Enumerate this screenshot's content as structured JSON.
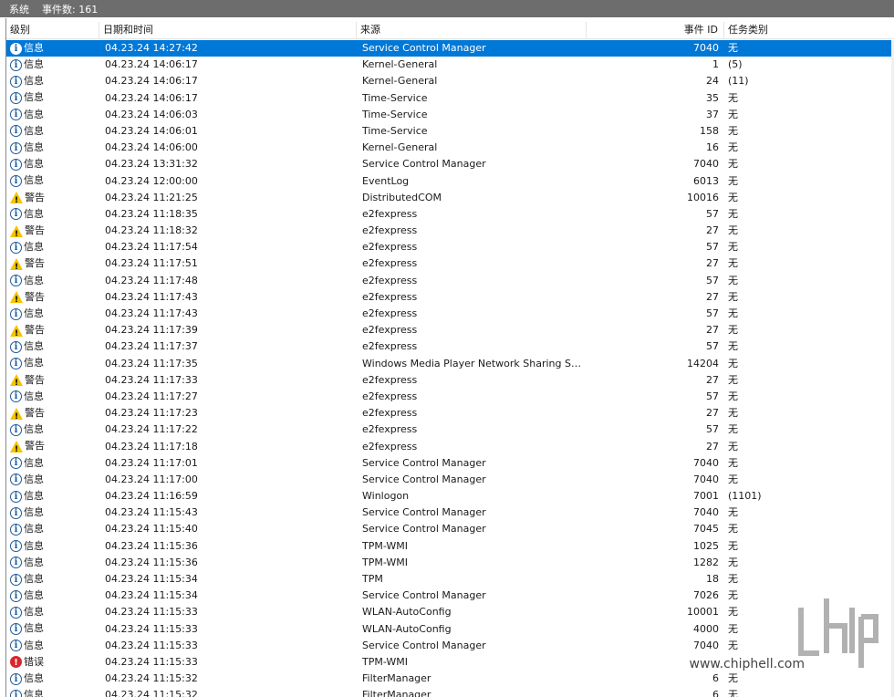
{
  "titlebar": {
    "title": "系统",
    "count": "事件数: 161"
  },
  "columns": {
    "level": "级别",
    "date": "日期和时间",
    "source": "来源",
    "id": "事件 ID",
    "task": "任务类别"
  },
  "watermark": "www.chiphell.com",
  "rows": [
    {
      "level": "信息",
      "icon": "info",
      "date": "04.23.24 14:27:42",
      "source": "Service Control Manager",
      "id": "7040",
      "task": "无"
    },
    {
      "level": "信息",
      "icon": "info",
      "date": "04.23.24 14:06:17",
      "source": "Kernel-General",
      "id": "1",
      "task": "(5)"
    },
    {
      "level": "信息",
      "icon": "info",
      "date": "04.23.24 14:06:17",
      "source": "Kernel-General",
      "id": "24",
      "task": "(11)"
    },
    {
      "level": "信息",
      "icon": "info",
      "date": "04.23.24 14:06:17",
      "source": "Time-Service",
      "id": "35",
      "task": "无"
    },
    {
      "level": "信息",
      "icon": "info",
      "date": "04.23.24 14:06:03",
      "source": "Time-Service",
      "id": "37",
      "task": "无"
    },
    {
      "level": "信息",
      "icon": "info",
      "date": "04.23.24 14:06:01",
      "source": "Time-Service",
      "id": "158",
      "task": "无"
    },
    {
      "level": "信息",
      "icon": "info",
      "date": "04.23.24 14:06:00",
      "source": "Kernel-General",
      "id": "16",
      "task": "无"
    },
    {
      "level": "信息",
      "icon": "info",
      "date": "04.23.24 13:31:32",
      "source": "Service Control Manager",
      "id": "7040",
      "task": "无"
    },
    {
      "level": "信息",
      "icon": "info",
      "date": "04.23.24 12:00:00",
      "source": "EventLog",
      "id": "6013",
      "task": "无"
    },
    {
      "level": "警告",
      "icon": "warn",
      "date": "04.23.24 11:21:25",
      "source": "DistributedCOM",
      "id": "10016",
      "task": "无"
    },
    {
      "level": "信息",
      "icon": "info",
      "date": "04.23.24 11:18:35",
      "source": "e2fexpress",
      "id": "57",
      "task": "无"
    },
    {
      "level": "警告",
      "icon": "warn",
      "date": "04.23.24 11:18:32",
      "source": "e2fexpress",
      "id": "27",
      "task": "无"
    },
    {
      "level": "信息",
      "icon": "info",
      "date": "04.23.24 11:17:54",
      "source": "e2fexpress",
      "id": "57",
      "task": "无"
    },
    {
      "level": "警告",
      "icon": "warn",
      "date": "04.23.24 11:17:51",
      "source": "e2fexpress",
      "id": "27",
      "task": "无"
    },
    {
      "level": "信息",
      "icon": "info",
      "date": "04.23.24 11:17:48",
      "source": "e2fexpress",
      "id": "57",
      "task": "无"
    },
    {
      "level": "警告",
      "icon": "warn",
      "date": "04.23.24 11:17:43",
      "source": "e2fexpress",
      "id": "27",
      "task": "无"
    },
    {
      "level": "信息",
      "icon": "info",
      "date": "04.23.24 11:17:43",
      "source": "e2fexpress",
      "id": "57",
      "task": "无"
    },
    {
      "level": "警告",
      "icon": "warn",
      "date": "04.23.24 11:17:39",
      "source": "e2fexpress",
      "id": "27",
      "task": "无"
    },
    {
      "level": "信息",
      "icon": "info",
      "date": "04.23.24 11:17:37",
      "source": "e2fexpress",
      "id": "57",
      "task": "无"
    },
    {
      "level": "信息",
      "icon": "info",
      "date": "04.23.24 11:17:35",
      "source": "Windows Media Player Network Sharing Servi...",
      "id": "14204",
      "task": "无"
    },
    {
      "level": "警告",
      "icon": "warn",
      "date": "04.23.24 11:17:33",
      "source": "e2fexpress",
      "id": "27",
      "task": "无"
    },
    {
      "level": "信息",
      "icon": "info",
      "date": "04.23.24 11:17:27",
      "source": "e2fexpress",
      "id": "57",
      "task": "无"
    },
    {
      "level": "警告",
      "icon": "warn",
      "date": "04.23.24 11:17:23",
      "source": "e2fexpress",
      "id": "27",
      "task": "无"
    },
    {
      "level": "信息",
      "icon": "info",
      "date": "04.23.24 11:17:22",
      "source": "e2fexpress",
      "id": "57",
      "task": "无"
    },
    {
      "level": "警告",
      "icon": "warn",
      "date": "04.23.24 11:17:18",
      "source": "e2fexpress",
      "id": "27",
      "task": "无"
    },
    {
      "level": "信息",
      "icon": "info",
      "date": "04.23.24 11:17:01",
      "source": "Service Control Manager",
      "id": "7040",
      "task": "无"
    },
    {
      "level": "信息",
      "icon": "info",
      "date": "04.23.24 11:17:00",
      "source": "Service Control Manager",
      "id": "7040",
      "task": "无"
    },
    {
      "level": "信息",
      "icon": "info",
      "date": "04.23.24 11:16:59",
      "source": "Winlogon",
      "id": "7001",
      "task": "(1101)"
    },
    {
      "level": "信息",
      "icon": "info",
      "date": "04.23.24 11:15:43",
      "source": "Service Control Manager",
      "id": "7040",
      "task": "无"
    },
    {
      "level": "信息",
      "icon": "info",
      "date": "04.23.24 11:15:40",
      "source": "Service Control Manager",
      "id": "7045",
      "task": "无"
    },
    {
      "level": "信息",
      "icon": "info",
      "date": "04.23.24 11:15:36",
      "source": "TPM-WMI",
      "id": "1025",
      "task": "无"
    },
    {
      "level": "信息",
      "icon": "info",
      "date": "04.23.24 11:15:36",
      "source": "TPM-WMI",
      "id": "1282",
      "task": "无"
    },
    {
      "level": "信息",
      "icon": "info",
      "date": "04.23.24 11:15:34",
      "source": "TPM",
      "id": "18",
      "task": "无"
    },
    {
      "level": "信息",
      "icon": "info",
      "date": "04.23.24 11:15:34",
      "source": "Service Control Manager",
      "id": "7026",
      "task": "无"
    },
    {
      "level": "信息",
      "icon": "info",
      "date": "04.23.24 11:15:33",
      "source": "WLAN-AutoConfig",
      "id": "10001",
      "task": "无"
    },
    {
      "level": "信息",
      "icon": "info",
      "date": "04.23.24 11:15:33",
      "source": "WLAN-AutoConfig",
      "id": "4000",
      "task": "无"
    },
    {
      "level": "信息",
      "icon": "info",
      "date": "04.23.24 11:15:33",
      "source": "Service Control Manager",
      "id": "7040",
      "task": "无"
    },
    {
      "level": "错误",
      "icon": "error",
      "date": "04.23.24 11:15:33",
      "source": "TPM-WMI",
      "id": "",
      "task": ""
    },
    {
      "level": "信息",
      "icon": "info",
      "date": "04.23.24 11:15:32",
      "source": "FilterManager",
      "id": "6",
      "task": "无"
    },
    {
      "level": "信息",
      "icon": "info",
      "date": "04.23.24 11:15:32",
      "source": "FilterManager",
      "id": "6",
      "task": "无"
    }
  ],
  "selected_row": 0
}
